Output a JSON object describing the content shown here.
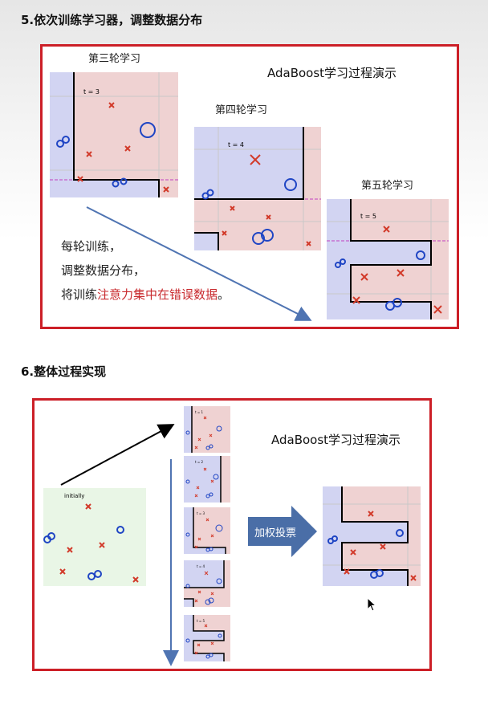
{
  "section5": {
    "heading": "5.依次训练学习器，调整数据分布",
    "demo_title": "AdaBoost学习过程演示",
    "rounds": [
      {
        "label": "第三轮学习",
        "t": "t = 3"
      },
      {
        "label": "第四轮学习",
        "t": "t = 4"
      },
      {
        "label": "第五轮学习",
        "t": "t = 5"
      }
    ],
    "text_line1": "每轮训练，",
    "text_line2": "调整数据分布，",
    "text_line3_prefix": "将训练",
    "text_line3_highlight": "注意力集中在错误数据",
    "text_line3_suffix": "。"
  },
  "section6": {
    "heading": "6.整体过程实现",
    "demo_title": "AdaBoost学习过程演示",
    "initial_label": "initially",
    "vote_label": "加权投票",
    "thumb_labels": [
      "t = 1",
      "t = 2",
      "t = 3",
      "t = 4",
      "t = 5"
    ]
  },
  "colors": {
    "frame": "#cc1f27",
    "positive_region": "#d2d4f2",
    "negative_region": "#efd2d2",
    "circle": "#1f45c4",
    "cross": "#d23a2a",
    "arrow_blue": "#4f74b2",
    "vote_arrow": "#4a6ea7",
    "highlight_text": "#c8282c"
  }
}
